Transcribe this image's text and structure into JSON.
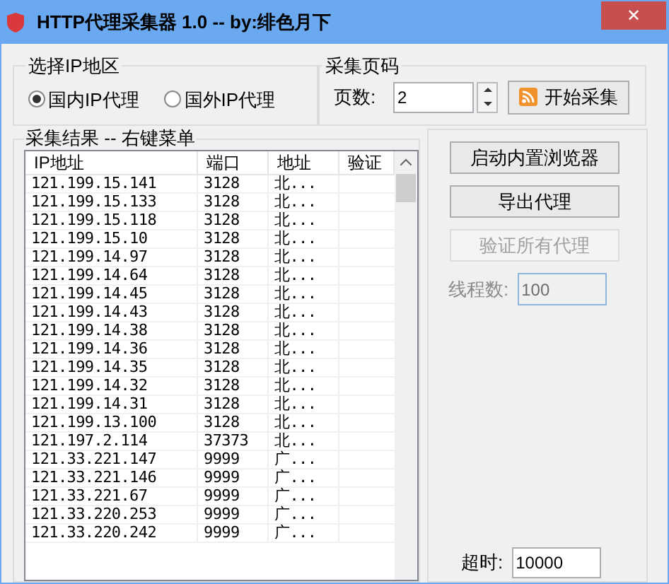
{
  "window": {
    "title": "HTTP代理采集器 1.0 -- by:绯色月下",
    "close": "✕"
  },
  "region_group": {
    "title": "选择IP地区",
    "options": [
      {
        "label": "国内IP代理",
        "selected": true
      },
      {
        "label": "国外IP代理",
        "selected": false
      }
    ]
  },
  "page_group": {
    "title": "采集页码",
    "label": "页数:",
    "value": "2",
    "button": "开始采集"
  },
  "results": {
    "title": "采集结果 -- 右键菜单",
    "columns": [
      "IP地址",
      "端口",
      "地址",
      "验证"
    ],
    "rows": [
      [
        "121.199.15.141",
        "3128",
        "北..."
      ],
      [
        "121.199.15.133",
        "3128",
        "北..."
      ],
      [
        "121.199.15.118",
        "3128",
        "北..."
      ],
      [
        "121.199.15.10",
        "3128",
        "北..."
      ],
      [
        "121.199.14.97",
        "3128",
        "北..."
      ],
      [
        "121.199.14.64",
        "3128",
        "北..."
      ],
      [
        "121.199.14.45",
        "3128",
        "北..."
      ],
      [
        "121.199.14.43",
        "3128",
        "北..."
      ],
      [
        "121.199.14.38",
        "3128",
        "北..."
      ],
      [
        "121.199.14.36",
        "3128",
        "北..."
      ],
      [
        "121.199.14.35",
        "3128",
        "北..."
      ],
      [
        "121.199.14.32",
        "3128",
        "北..."
      ],
      [
        "121.199.14.31",
        "3128",
        "北..."
      ],
      [
        "121.199.13.100",
        "3128",
        "北..."
      ],
      [
        "121.197.2.114",
        "37373",
        "北..."
      ],
      [
        "121.33.221.147",
        "9999",
        "广..."
      ],
      [
        "121.33.221.146",
        "9999",
        "广..."
      ],
      [
        "121.33.221.67",
        "9999",
        "广..."
      ],
      [
        "121.33.220.253",
        "9999",
        "广..."
      ],
      [
        "121.33.220.242",
        "9999",
        "广..."
      ]
    ]
  },
  "actions": [
    {
      "label": "启动内置浏览器",
      "disabled": false
    },
    {
      "label": "导出代理",
      "disabled": false
    },
    {
      "label": "验证所有代理",
      "disabled": true
    }
  ],
  "threads": {
    "label": "线程数:",
    "value": "100",
    "disabled": true
  },
  "timeout": {
    "label": "超时:",
    "value": "10000",
    "disabled": false
  }
}
